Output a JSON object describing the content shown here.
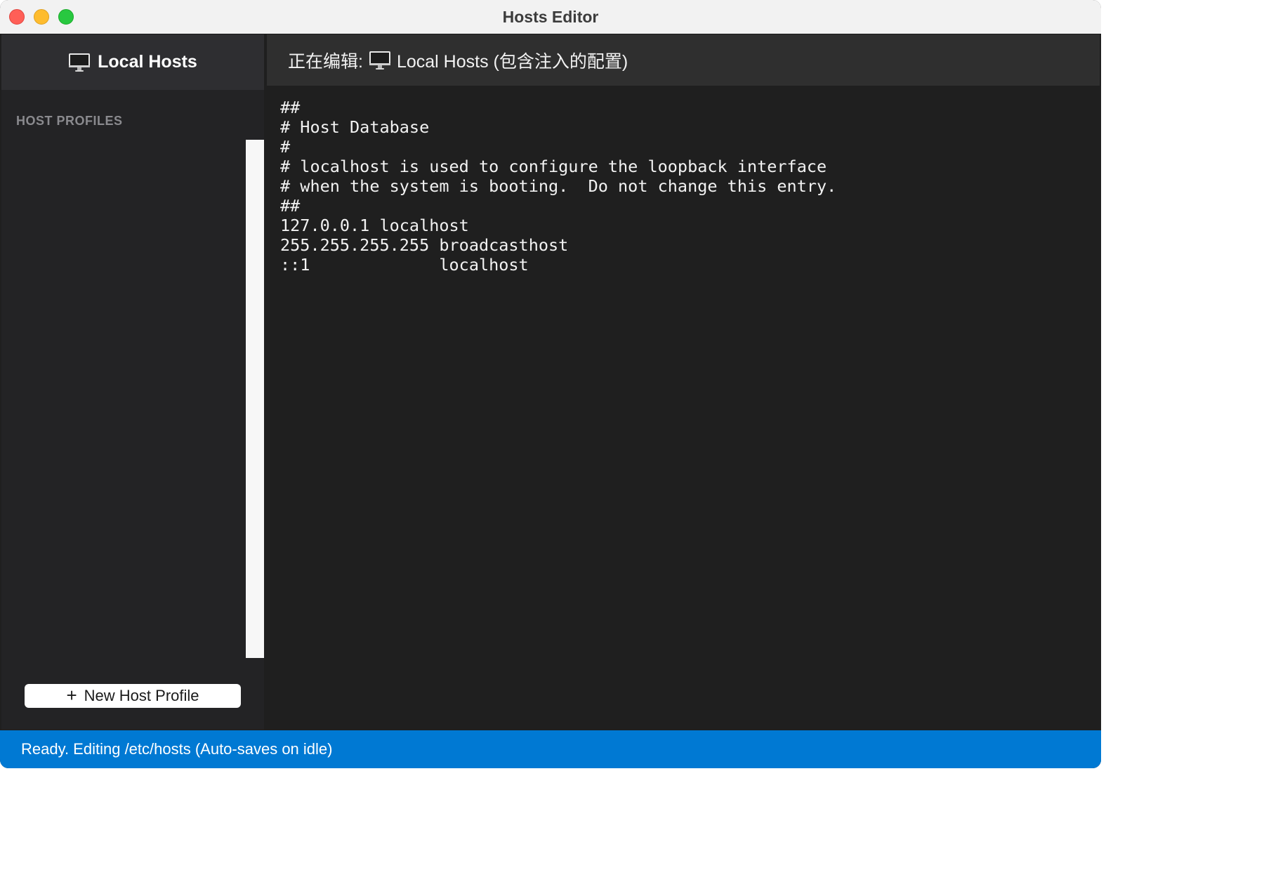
{
  "window": {
    "title": "Hosts Editor"
  },
  "sidebar": {
    "header_icon": "monitor-icon",
    "header_title": "Local Hosts",
    "section_label": "HOST PROFILES",
    "profiles": [],
    "new_profile_button": {
      "icon": "plus-icon",
      "icon_glyph": "+",
      "label": "New Host Profile"
    }
  },
  "editor": {
    "header_prefix": "正在编辑:",
    "header_icon": "monitor-icon",
    "header_name": "Local Hosts (包含注入的配置)",
    "content": "##\n# Host Database\n#\n# localhost is used to configure the loopback interface\n# when the system is booting.  Do not change this entry.\n##\n127.0.0.1 localhost\n255.255.255.255 broadcasthost\n::1             localhost"
  },
  "statusbar": {
    "text": "Ready. Editing /etc/hosts (Auto-saves on idle)"
  },
  "colors": {
    "statusbar": "#0079d3",
    "sidebar_bg": "#232325",
    "editor_bg": "#1f1f1f",
    "close": "#ff5f57",
    "minimize": "#febc2e",
    "maximize": "#28c840"
  }
}
